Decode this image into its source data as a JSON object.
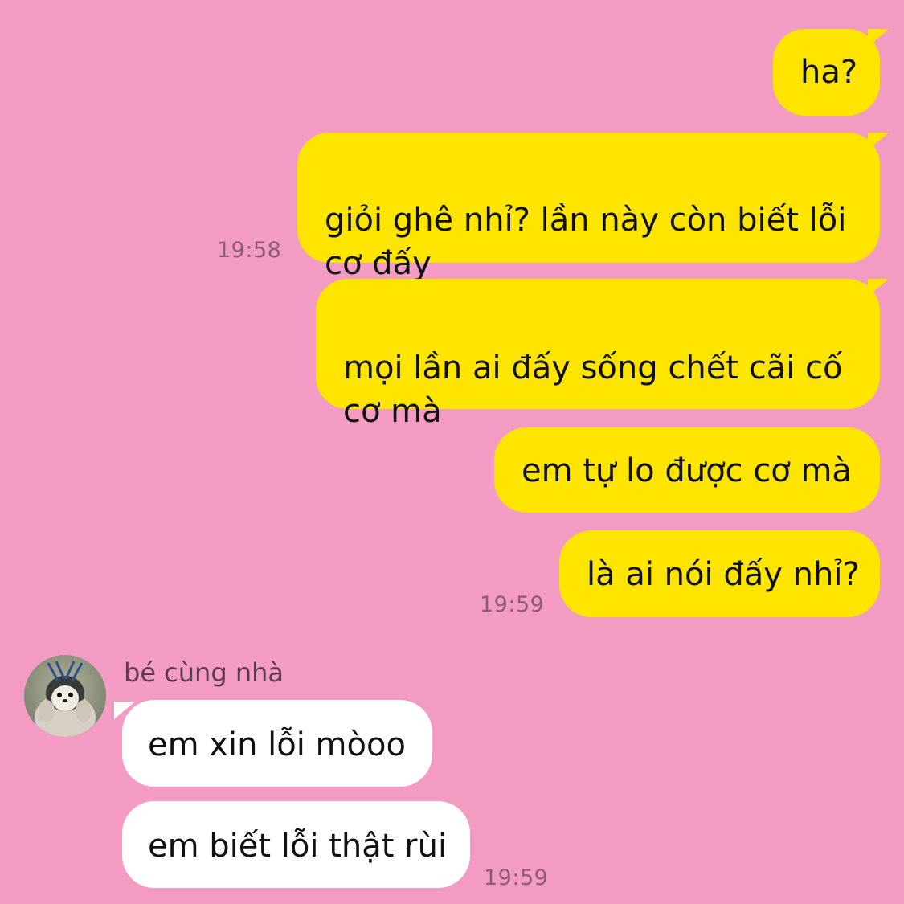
{
  "colors": {
    "background": "#f39bc3",
    "outgoing_bubble": "#fee500",
    "incoming_bubble": "#ffffff",
    "timestamp": "#8a5b72"
  },
  "messages_out": [
    {
      "text": "ha?"
    },
    {
      "text": "giỏi ghê nhỉ? lần này còn biết lỗi\ncơ đấy",
      "time": "19:58"
    },
    {
      "text": "mọi lần ai đấy sống chết cãi cố\ncơ mà"
    },
    {
      "text": "em tự lo được cơ mà"
    },
    {
      "text": "là ai nói đấy nhỉ?",
      "time": "19:59"
    }
  ],
  "contact": {
    "name": "bé cùng nhà",
    "avatar_icon": "penguin-avatar-icon"
  },
  "messages_in": [
    {
      "text": "em xin lỗi mòoo"
    },
    {
      "text": "em biết lỗi thật rùi",
      "time": "19:59"
    }
  ]
}
